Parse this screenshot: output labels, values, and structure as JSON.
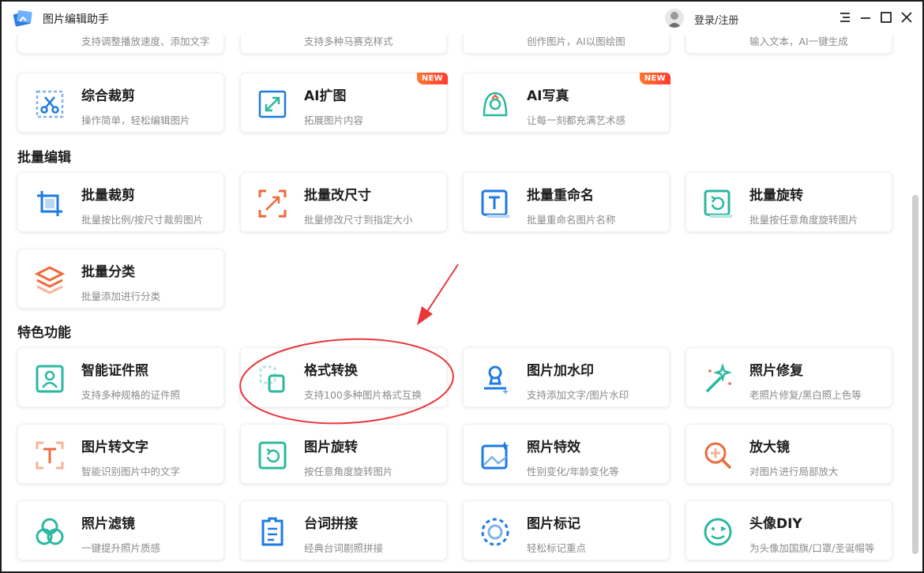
{
  "app": {
    "title": "图片编辑助手",
    "login_label": "登录/注册",
    "window_controls": [
      "menu-icon",
      "minimize-icon",
      "maximize-icon",
      "close-icon"
    ]
  },
  "colors": {
    "accent_blue": "#1e7be0",
    "accent_orange": "#ef6a3c",
    "accent_teal": "#2bb8a0",
    "badge": "#ff4a30",
    "annotation_red": "#e8373b"
  },
  "top_cut_cards": [
    {
      "desc": "支持调整播放速度、添加文字"
    },
    {
      "desc": "支持多种马赛克样式"
    },
    {
      "desc": "创作图片，AI以图绘图"
    },
    {
      "desc": "输入文本，AI一键生成"
    }
  ],
  "row_ai": [
    {
      "title": "综合裁剪",
      "desc": "操作简单，轻松编辑图片",
      "icon": "crop-scissors-icon"
    },
    {
      "title": "AI扩图",
      "desc": "拓展图片内容",
      "badge": "NEW",
      "icon": "expand-arrows-icon"
    },
    {
      "title": "AI写真",
      "desc": "让每一刻都充满艺术感",
      "badge": "NEW",
      "icon": "portrait-icon"
    }
  ],
  "sections": {
    "batch": {
      "title": "批量编辑",
      "items": [
        {
          "title": "批量裁剪",
          "desc": "批量按比例/按尺寸裁剪图片",
          "icon": "batch-crop-icon"
        },
        {
          "title": "批量改尺寸",
          "desc": "批量修改尺寸到指定大小",
          "icon": "resize-icon"
        },
        {
          "title": "批量重命名",
          "desc": "批量重命名图片名称",
          "icon": "rename-icon"
        },
        {
          "title": "批量旋转",
          "desc": "批量按任意角度旋转图片",
          "icon": "rotate-icon"
        },
        {
          "title": "批量分类",
          "desc": "批量添加进行分类",
          "icon": "layers-icon"
        }
      ]
    },
    "features": {
      "title": "特色功能",
      "items": [
        {
          "title": "智能证件照",
          "desc": "支持多种规格的证件照",
          "icon": "id-photo-icon"
        },
        {
          "title": "格式转换",
          "desc": "支持100多种图片格式互换",
          "icon": "format-convert-icon"
        },
        {
          "title": "图片加水印",
          "desc": "支持添加文字/图片水印",
          "icon": "stamp-icon"
        },
        {
          "title": "照片修复",
          "desc": "老照片修复/黑白照上色等",
          "icon": "magic-wand-icon"
        },
        {
          "title": "图片转文字",
          "desc": "智能识别图片中的文字",
          "icon": "ocr-text-icon"
        },
        {
          "title": "图片旋转",
          "desc": "按任意角度旋转图片",
          "icon": "image-rotate-icon"
        },
        {
          "title": "照片特效",
          "desc": "性别变化/年龄变化等",
          "icon": "photo-effect-icon"
        },
        {
          "title": "放大镜",
          "desc": "对图片进行局部放大",
          "icon": "magnifier-icon"
        },
        {
          "title": "照片滤镜",
          "desc": "一键提升照片质感",
          "icon": "filter-icon"
        },
        {
          "title": "台词拼接",
          "desc": "经典台词剧照拼接",
          "icon": "script-icon"
        },
        {
          "title": "图片标记",
          "desc": "轻松标记重点",
          "icon": "mark-icon"
        },
        {
          "title": "头像DIY",
          "desc": "为头像加国旗/口罩/圣诞帽等",
          "icon": "avatar-diy-icon"
        }
      ]
    }
  }
}
